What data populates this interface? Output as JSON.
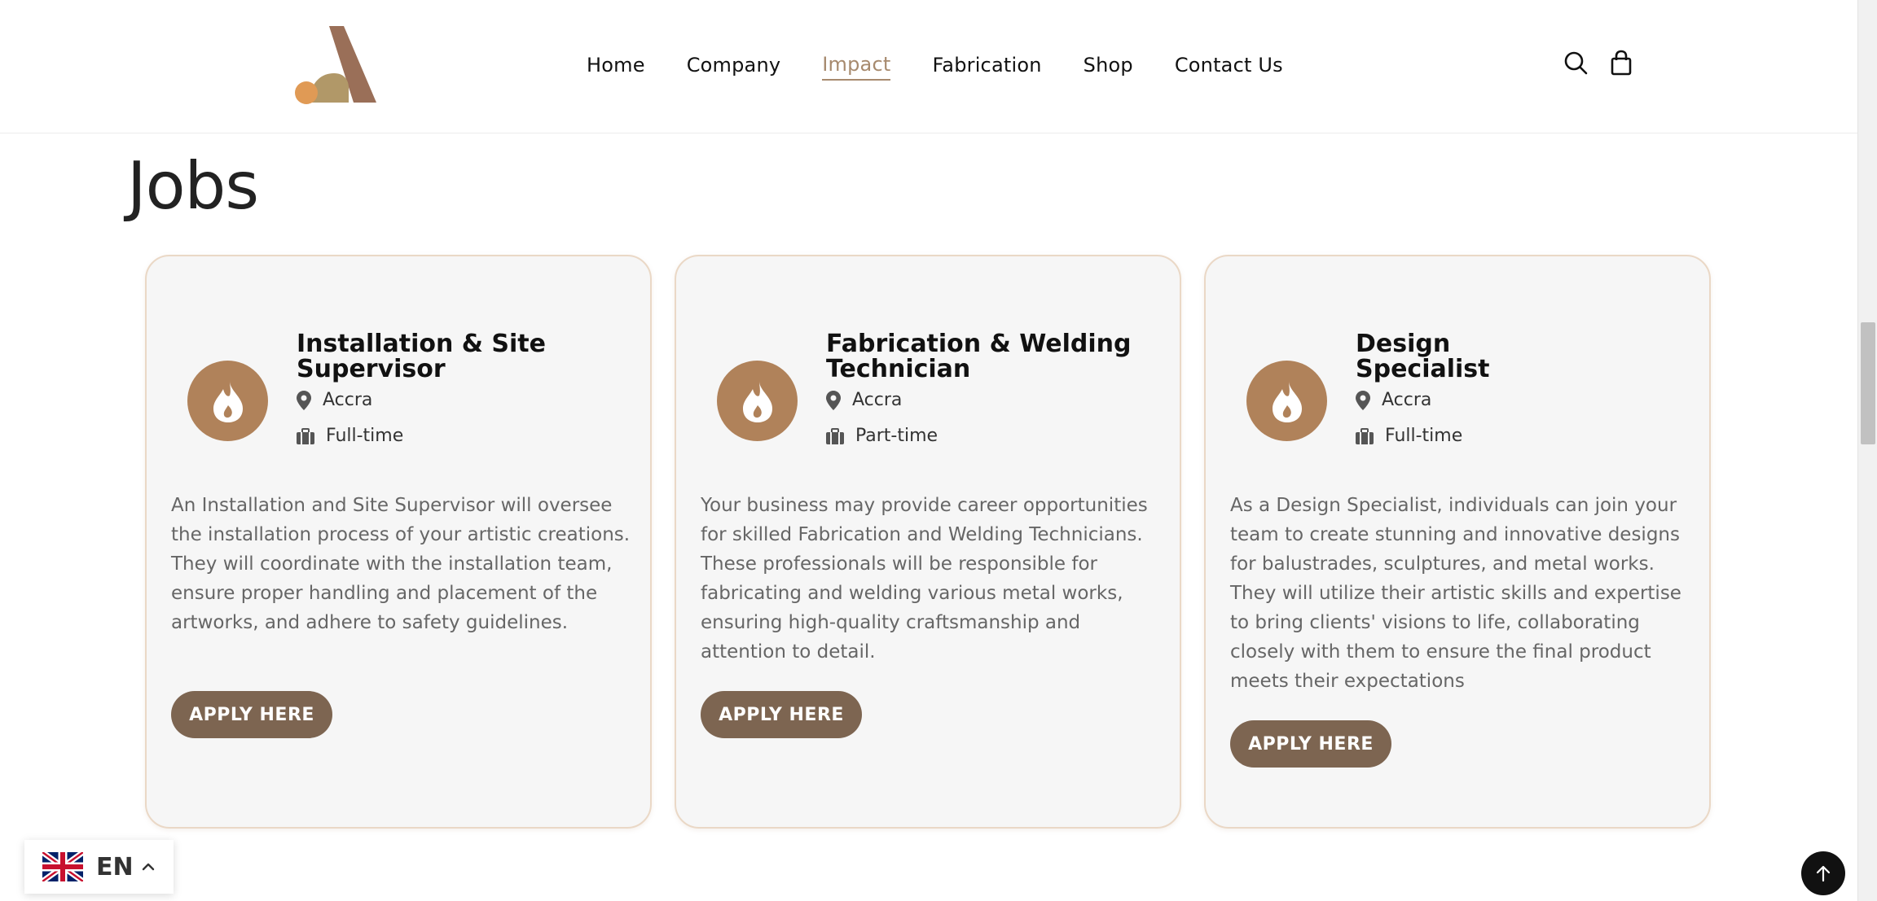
{
  "nav": {
    "items": [
      {
        "label": "Home",
        "active": false
      },
      {
        "label": "Company",
        "active": false
      },
      {
        "label": "Impact",
        "active": true
      },
      {
        "label": "Fabrication",
        "active": false
      },
      {
        "label": "Shop",
        "active": false
      },
      {
        "label": "Contact Us",
        "active": false
      }
    ],
    "icons": [
      "search-icon",
      "shopping-bag-icon"
    ]
  },
  "page": {
    "title": "Jobs"
  },
  "jobs": [
    {
      "title": "Installation & Site Supervisor",
      "location": "Accra",
      "type": "Full-time",
      "description": "An Installation and Site Supervisor will oversee the installation process of your artistic creations. They will coordinate with the installation team, ensure proper handling and placement of the artworks, and adhere to safety guidelines.",
      "button": "APPLY HERE"
    },
    {
      "title": "Fabrication & Welding Technician",
      "location": "Accra",
      "type": "Part-time",
      "description": "Your business may provide career opportunities for skilled Fabrication and Welding Technicians. These professionals will be responsible for fabricating and welding various metal works, ensuring high-quality craftsmanship and attention to detail.",
      "button": "APPLY HERE"
    },
    {
      "title": "Design Specialist",
      "location": "Accra",
      "type": "Full-time",
      "description": "As a Design Specialist, individuals can join your team to create stunning and innovative designs for balustrades, sculptures, and metal works. They will utilize their artistic skills and expertise to bring clients' visions to life, collaborating closely with them to ensure the final product meets their expectations",
      "button": "APPLY HERE"
    }
  ],
  "language": {
    "code": "EN",
    "flag": "uk-flag-icon"
  },
  "colors": {
    "accent": "#a78a6e",
    "button": "#7d6551",
    "icon_circle": "#b0825a",
    "card_border": "#ead8c6"
  }
}
